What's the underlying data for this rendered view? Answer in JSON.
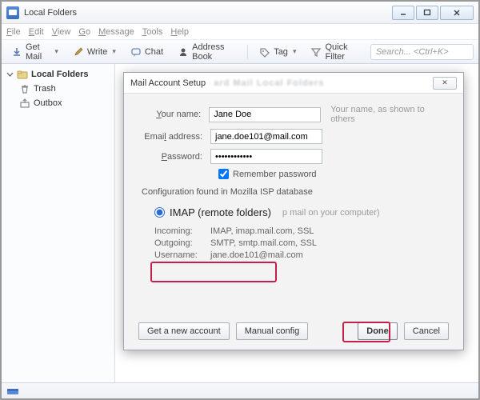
{
  "window": {
    "title": "Local Folders"
  },
  "menu": {
    "file": "File",
    "edit": "Edit",
    "view": "View",
    "go": "Go",
    "message": "Message",
    "tools": "Tools",
    "help": "Help"
  },
  "toolbar": {
    "getmail": "Get Mail",
    "write": "Write",
    "chat": "Chat",
    "addressbook": "Address Book",
    "tag": "Tag",
    "quickfilter": "Quick Filter",
    "search_placeholder": "Search... <Ctrl+K>"
  },
  "sidebar": {
    "root": "Local Folders",
    "items": [
      {
        "label": "Trash"
      },
      {
        "label": "Outbox"
      }
    ]
  },
  "dialog": {
    "title": "Mail Account Setup",
    "blurred": "ard  Mail    Local  Folders",
    "labels": {
      "yourname": "Your name:",
      "email": "Email address:",
      "password": "Password:",
      "remember": "Remember password"
    },
    "values": {
      "yourname": "Jane Doe",
      "email": "jane.doe101@mail.com",
      "password": "••••••••••••"
    },
    "hint_name": "Your name, as shown to others",
    "config_found": "Configuration found in Mozilla ISP database",
    "radio": {
      "imap": "IMAP (remote folders)",
      "pop_hint": "p mail on your computer)"
    },
    "server": {
      "incoming_k": "Incoming:",
      "incoming_v": "IMAP, imap.mail.com, SSL",
      "outgoing_k": "Outgoing:",
      "outgoing_v": "SMTP, smtp.mail.com, SSL",
      "username_k": "Username:",
      "username_v": "jane.doe101@mail.com"
    },
    "buttons": {
      "getnew": "Get a new account",
      "manual": "Manual config",
      "done": "Done",
      "cancel": "Cancel"
    }
  }
}
